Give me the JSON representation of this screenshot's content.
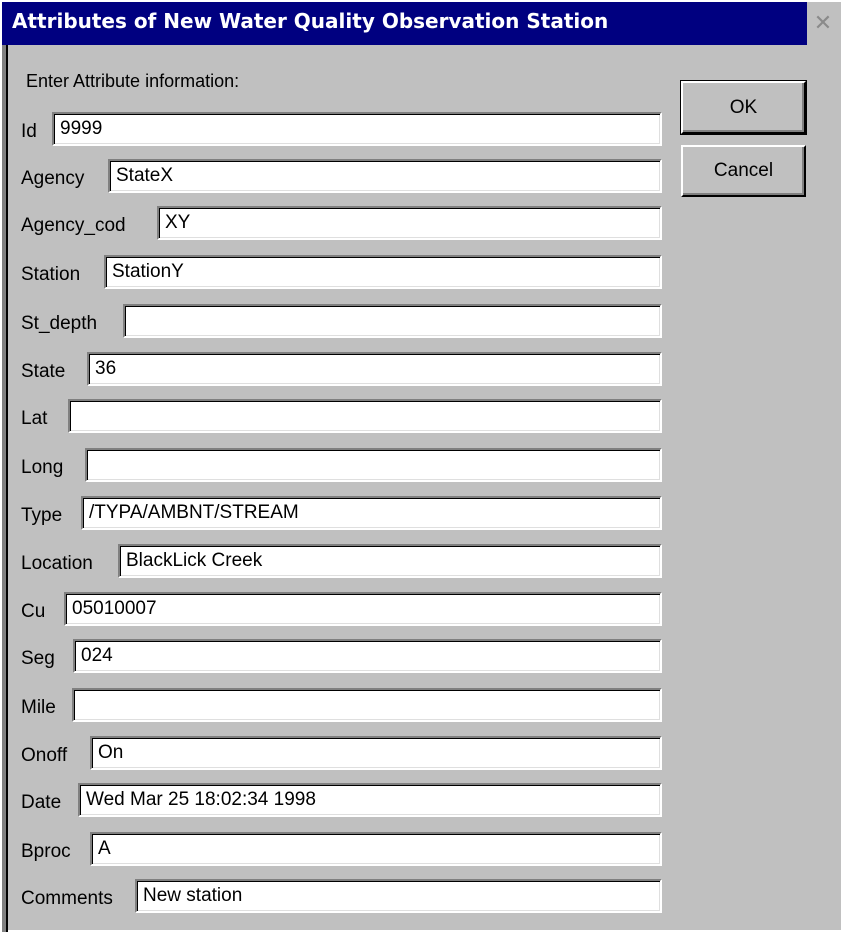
{
  "window": {
    "title": "Attributes of New Water Quality Observation Station",
    "close_glyph": "✕"
  },
  "form": {
    "heading": "Enter Attribute information:",
    "fields": [
      {
        "label": "Id",
        "value": "9999"
      },
      {
        "label": "Agency",
        "value": " StateX"
      },
      {
        "label": "Agency_cod",
        "value": " XY"
      },
      {
        "label": "Station",
        "value": " StationY"
      },
      {
        "label": "St_depth",
        "value": ""
      },
      {
        "label": "State",
        "value": "36"
      },
      {
        "label": "Lat",
        "value": ""
      },
      {
        "label": "Long",
        "value": ""
      },
      {
        "label": "Type",
        "value": " /TYPA/AMBNT/STREAM"
      },
      {
        "label": "Location",
        "value": " BlackLick Creek"
      },
      {
        "label": "Cu",
        "value": " 05010007"
      },
      {
        "label": "Seg",
        "value": " 024"
      },
      {
        "label": "Mile",
        "value": ""
      },
      {
        "label": "Onoff",
        "value": " On"
      },
      {
        "label": "Date",
        "value": "Wed Mar 25 18:02:34 1998"
      },
      {
        "label": "Bproc",
        "value": "A"
      },
      {
        "label": "Comments",
        "value": "New station"
      }
    ]
  },
  "buttons": {
    "ok_label": "OK",
    "cancel_label": "Cancel"
  }
}
